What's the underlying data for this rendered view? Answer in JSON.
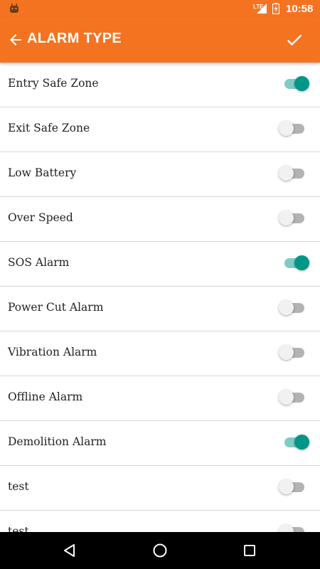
{
  "status_bar": {
    "network": "LTE",
    "time": "10:58"
  },
  "app_bar": {
    "title": "ALARM TYPE",
    "back_icon": "arrow-back-icon",
    "confirm_icon": "check-icon"
  },
  "colors": {
    "primary": "#f47321",
    "switch_on": "#009688",
    "switch_on_track": "#80cbc4"
  },
  "alarms": [
    {
      "label": "Entry Safe Zone",
      "enabled": true
    },
    {
      "label": "Exit Safe Zone",
      "enabled": false
    },
    {
      "label": "Low Battery",
      "enabled": false
    },
    {
      "label": "Over Speed",
      "enabled": false
    },
    {
      "label": "SOS Alarm",
      "enabled": true
    },
    {
      "label": "Power Cut Alarm",
      "enabled": false
    },
    {
      "label": "Vibration Alarm",
      "enabled": false
    },
    {
      "label": "Offline Alarm",
      "enabled": false
    },
    {
      "label": "Demolition Alarm",
      "enabled": true
    },
    {
      "label": "test",
      "enabled": false
    },
    {
      "label": "test",
      "enabled": false
    }
  ]
}
